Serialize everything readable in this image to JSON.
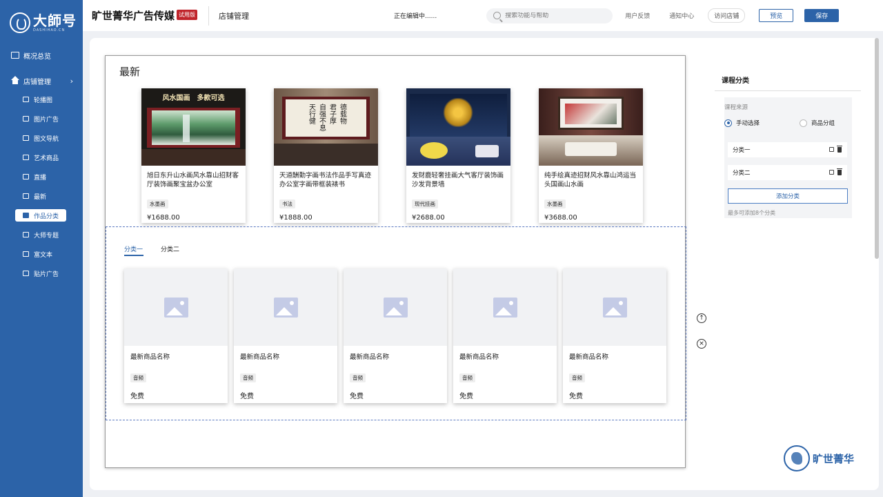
{
  "sidebar": {
    "logo_title": "大師号",
    "logo_sub": "DASHIHAO.CN",
    "overview": "概况总览",
    "group": "店铺管理",
    "items": [
      {
        "label": "轮播图",
        "icon": "carousel-icon"
      },
      {
        "label": "图片广告",
        "icon": "image-ad-icon"
      },
      {
        "label": "图文导航",
        "icon": "nav-icon"
      },
      {
        "label": "艺术商品",
        "icon": "art-goods-icon"
      },
      {
        "label": "直播",
        "icon": "live-icon"
      },
      {
        "label": "最新",
        "icon": "latest-icon"
      },
      {
        "label": "作品分类",
        "icon": "works-category-icon",
        "active": true
      },
      {
        "label": "大师专题",
        "icon": "master-icon"
      },
      {
        "label": "富文本",
        "icon": "rich-text-icon"
      },
      {
        "label": "贴片广告",
        "icon": "sticker-ad-icon"
      }
    ]
  },
  "topbar": {
    "brand": "旷世菁华广告传媒",
    "trial": "试用版",
    "store": "店铺管理",
    "editing": "正在编辑中......",
    "search_placeholder": "搜索功能与帮助",
    "feedback": "用户反馈",
    "notice": "通知中心",
    "visit": "访问店铺",
    "preview": "预览",
    "save": "保存"
  },
  "canvas": {
    "section_title": "最新",
    "products": [
      {
        "name": "旭日东升山水画风水靠山招财客厅装饰画聚宝盆办公室",
        "tag": "水墨画",
        "price": "¥1688.00",
        "banner": "风水国画　多款可选"
      },
      {
        "name": "天道酬勤字画书法作品手写真迹办公室字画带框装裱书",
        "tag": "书法",
        "price": "¥1888.00"
      },
      {
        "name": "发财鹿轻奢挂画大气客厅装饰画沙发背景墙",
        "tag": "现代挂画",
        "price": "¥2688.00"
      },
      {
        "name": "纯手绘真迹招财风水靠山鸿运当头国画山水画",
        "tag": "水墨画",
        "price": "¥3688.00"
      }
    ],
    "tabs": [
      "分类一",
      "分类二"
    ],
    "cards": [
      {
        "name": "最新商品名称",
        "tag": "音频",
        "price": "免费"
      },
      {
        "name": "最新商品名称",
        "tag": "音频",
        "price": "免费"
      },
      {
        "name": "最新商品名称",
        "tag": "音频",
        "price": "免费"
      },
      {
        "name": "最新商品名称",
        "tag": "音频",
        "price": "免费"
      },
      {
        "name": "最新商品名称",
        "tag": "音频",
        "price": "免费"
      }
    ],
    "move_up": "↑",
    "remove": "×"
  },
  "panel": {
    "title": "课程分类",
    "source_label": "课程来源",
    "option_manual": "手动选择",
    "option_group": "商品分组",
    "categories": [
      "分类一",
      "分类二"
    ],
    "add_button": "添加分类",
    "hint": "最多可添加8个分类"
  },
  "watermark": "旷世菁华"
}
